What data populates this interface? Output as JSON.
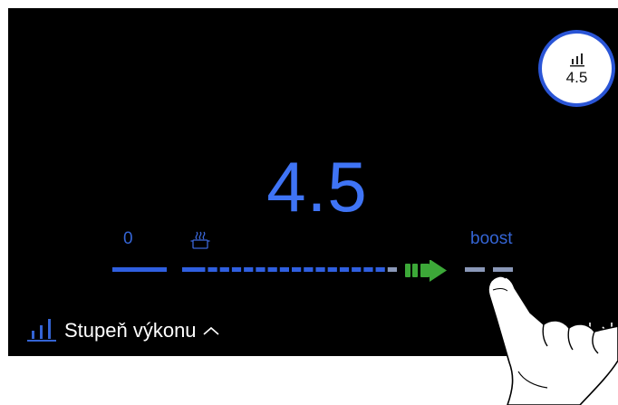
{
  "power": {
    "value": "4.5",
    "badge_value": "4.5",
    "min_label": "0",
    "max_label": "boost",
    "level_fraction": 0.9
  },
  "footer": {
    "label": "Stupeň výkonu"
  },
  "icons": [
    "power-bars-icon",
    "pot-steam-icon",
    "drag-arrow-icon",
    "chevron-up-icon",
    "exit-arrow-icon"
  ],
  "colors": {
    "accent_blue": "#3f74f5",
    "active_segment": "#2f5fe0",
    "inactive_segment": "#8a98b8",
    "arrow_green": "#3ca838"
  }
}
